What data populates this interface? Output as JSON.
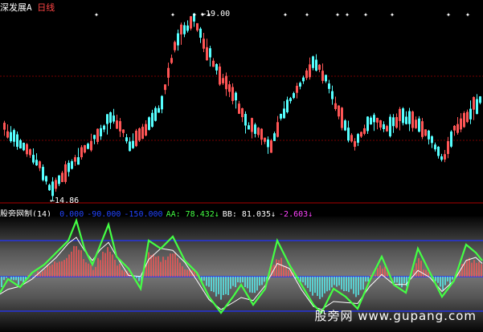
{
  "main_chart": {
    "stock_name": "深发展A",
    "period": "日线",
    "high_label": "19.00",
    "low_label": "14.86",
    "marker_glyph": "✦",
    "colors": {
      "up": "#ff5555",
      "down": "#55ffff",
      "title": "#ffffff",
      "period": "#ff4444"
    }
  },
  "indicator": {
    "name": "股旁网制(14)",
    "items": [
      {
        "text": "0.000",
        "color": "#2244ff"
      },
      {
        "text": "-90.000",
        "color": "#2244ff"
      },
      {
        "text": "-150.000",
        "color": "#2244ff"
      },
      {
        "text": "AA: 78.432↓",
        "color": "#44ff44"
      },
      {
        "text": "BB: 81.035↓",
        "color": "#ffffff"
      },
      {
        "text": "-2.603↓",
        "color": "#ff44ff"
      }
    ],
    "colors": {
      "aa": "#44ff44",
      "bb": "#ffffff",
      "level": "#2233ff",
      "hist_pos": "#ff5555",
      "hist_neg": "#55ffff"
    }
  },
  "watermark": "股旁网 www.gupang.com"
}
